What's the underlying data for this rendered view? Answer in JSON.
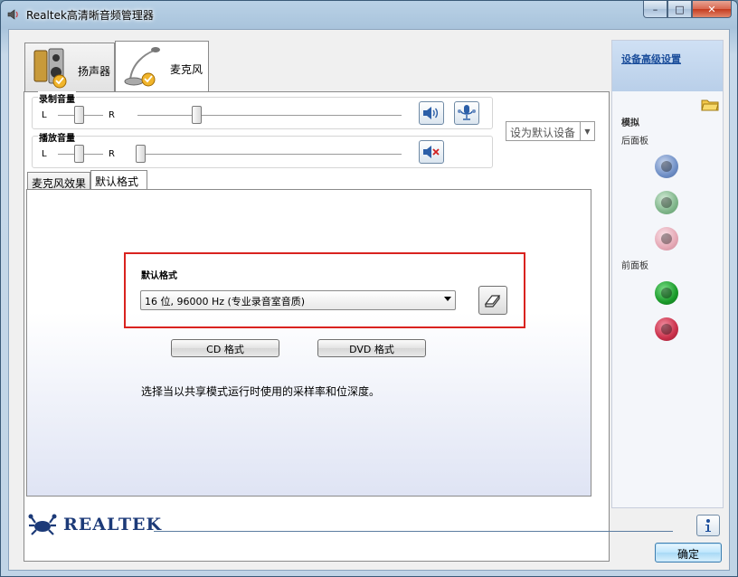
{
  "window": {
    "title": "Realtek高清晰音频管理器",
    "minimize": "–",
    "maximize": "□",
    "close": "✕"
  },
  "device_tabs": [
    {
      "label": "扬声器",
      "icon": "speaker-icon"
    },
    {
      "label": "麦克风",
      "icon": "microphone-icon"
    }
  ],
  "recording_volume": {
    "title": "录制音量",
    "left": "L",
    "right": "R"
  },
  "playback_volume": {
    "title": "播放音量",
    "left": "L",
    "right": "R"
  },
  "set_default_device": "设为默认设备",
  "sub_tabs": [
    {
      "label": "麦克风效果"
    },
    {
      "label": "默认格式"
    }
  ],
  "default_format": {
    "label": "默认格式",
    "selected": "16 位, 96000 Hz (专业录音室音质)",
    "cd_button": "CD 格式",
    "dvd_button": "DVD 格式",
    "description": "选择当以共享模式运行时使用的采样率和位深度。"
  },
  "right_panel": {
    "advanced_link": "设备高级设置",
    "analog": "模拟",
    "back_panel": "后面板",
    "front_panel": "前面板",
    "back_jacks": [
      "#6f8fc6",
      "#7fb58a",
      "#e5a8b5"
    ],
    "front_jacks": [
      "#1a9a2a",
      "#c9304a"
    ]
  },
  "footer": {
    "logo": "REALTEK",
    "ok": "确定"
  },
  "colors": {
    "highlight_box": "#d9231f",
    "accent": "#1d4f9c"
  }
}
